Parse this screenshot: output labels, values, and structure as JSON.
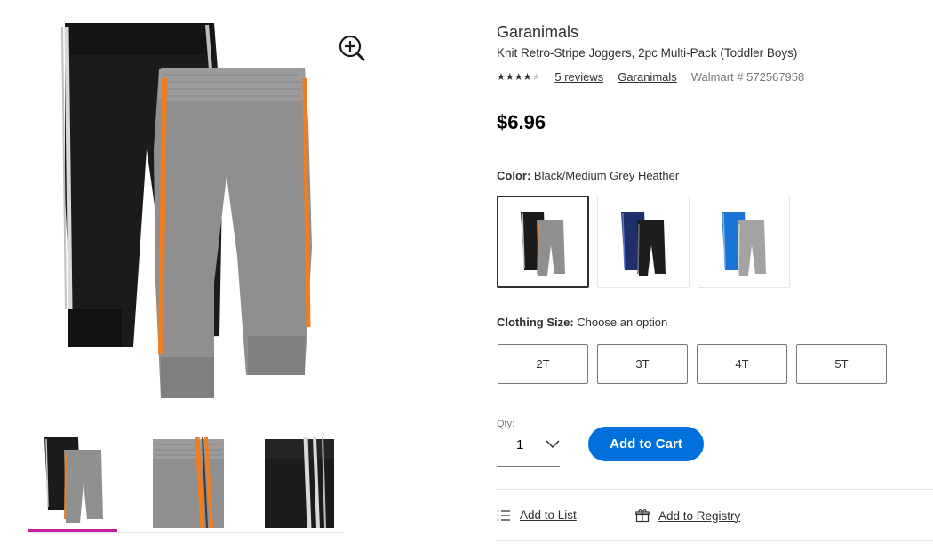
{
  "product": {
    "brand": "Garanimals",
    "title": "Knit Retro-Stripe Joggers, 2pc Multi-Pack (Toddler Boys)",
    "rating": 4,
    "rating_max": 5,
    "reviews_link": "5 reviews",
    "brand_link": "Garanimals",
    "sku": "Walmart # 572567958",
    "price": "$6.96"
  },
  "color_option": {
    "label": "Color:",
    "value": "Black/Medium Grey Heather",
    "swatches": [
      "black-grey",
      "navy-black",
      "blue-grey"
    ],
    "selected": 0
  },
  "size_option": {
    "label": "Clothing Size:",
    "value": "Choose an option",
    "sizes": [
      "2T",
      "3T",
      "4T",
      "5T"
    ]
  },
  "quantity": {
    "label": "Qty:",
    "value": "1"
  },
  "buttons": {
    "add_to_cart": "Add to Cart",
    "add_to_list": "Add to List",
    "add_to_registry": "Add to Registry"
  },
  "gallery": {
    "selected_thumb": 0,
    "thumbs": [
      "pair-front",
      "waist-closeup",
      "stripe-closeup"
    ]
  },
  "colors": {
    "accent_blue": "#0071dc",
    "thumb_underline": "#c51f9c",
    "stripe_orange": "#f07d1f"
  }
}
